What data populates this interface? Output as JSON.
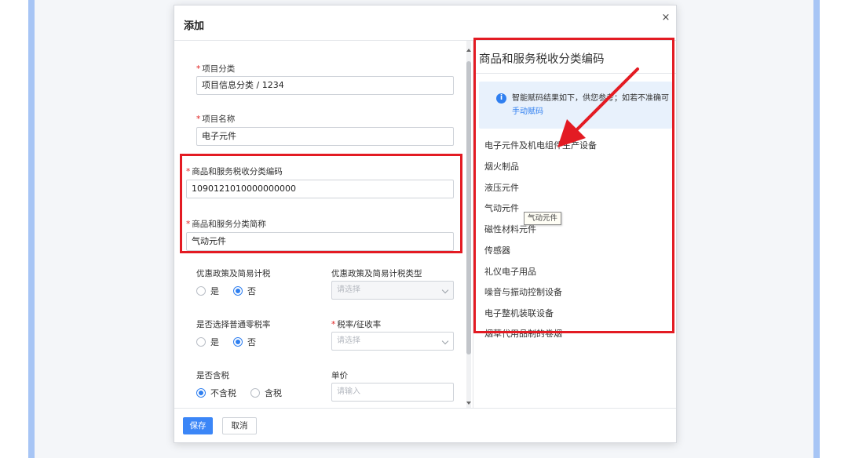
{
  "modal": {
    "title": "添加",
    "close": "×"
  },
  "form": {
    "category": {
      "label": "项目分类",
      "value": "项目信息分类 / 1234"
    },
    "item_name": {
      "label": "项目名称",
      "value": "电子元件"
    },
    "tax_code": {
      "label": "商品和服务税收分类编码",
      "value": "1090121010000000000"
    },
    "tax_abbr": {
      "label": "商品和服务分类简称",
      "value": "气动元件"
    },
    "preferential": {
      "label": "优惠政策及简易计税",
      "options": [
        "是",
        "否"
      ],
      "selected": "否"
    },
    "preferential_type": {
      "label": "优惠政策及简易计税类型",
      "placeholder": "请选择"
    },
    "zero_rate": {
      "label": "是否选择普通零税率",
      "options": [
        "是",
        "否"
      ],
      "selected": "否"
    },
    "tax_rate": {
      "label": "税率/征收率",
      "placeholder": "请选择"
    },
    "tax_included": {
      "label": "是否含税",
      "options": [
        "不含税",
        "含税"
      ],
      "selected": "不含税"
    },
    "unit_price": {
      "label": "单价",
      "placeholder": "请输入"
    },
    "required_mark": "*"
  },
  "right_panel": {
    "title": "商品和服务税收分类编码",
    "info_text": "智能赋码结果如下，供您参考；如若不准确可",
    "info_link": "手动赋码",
    "info_icon": "i",
    "items": [
      "电子元件及机电组件生产设备",
      "烟火制品",
      "液压元件",
      "气动元件",
      "磁性材料元件",
      "传感器",
      "礼仪电子用品",
      "噪音与振动控制设备",
      "电子整机装联设备",
      "烟草代用品制的卷烟"
    ],
    "tooltip": "气动元件"
  },
  "footer": {
    "save": "保存",
    "cancel": "取消"
  },
  "colors": {
    "accent": "#3b86f7",
    "highlight_red": "#e31b23",
    "info_bg": "#e8f1fc",
    "page_border": "#a7c5f5"
  }
}
